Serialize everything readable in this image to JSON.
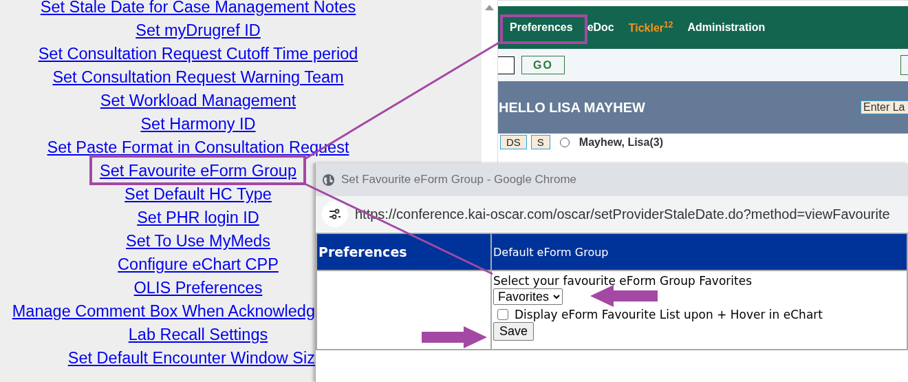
{
  "preference_links": [
    "Set Stale Date for Case Management Notes",
    "Set myDrugref ID",
    "Set Consultation Request Cutoff Time period",
    "Set Consultation Request Warning Team",
    "Set Workload Management",
    "Set Harmony ID",
    "Set Paste Format in Consultation Request",
    "Set Favourite eForm Group",
    "Set Default HC Type",
    "Set PHR login ID",
    "Set To Use MyMeds",
    "Configure eChart CPP",
    "OLIS Preferences",
    "Manage Comment Box When Acknowledg",
    "Lab Recall Settings",
    "Set Default Encounter Window Siz"
  ],
  "emr_window": {
    "nav": [
      {
        "label": "Preferences",
        "kind": "plain"
      },
      {
        "label": "eDoc",
        "kind": "plain"
      },
      {
        "label": "Tickler",
        "kind": "alert",
        "count": "12"
      },
      {
        "label": "Administration",
        "kind": "plain"
      }
    ],
    "search_button": "GO",
    "greeting": "HELLO LISA MAYHEW",
    "search_field": {
      "placeholder": "Enter La"
    },
    "schedule_row": {
      "buttons": [
        "DS",
        "S"
      ],
      "radio_selected": false,
      "provider": "Mayhew, Lisa(3)"
    }
  },
  "popup": {
    "title": "Set Favourite eForm Group - Google Chrome",
    "url": "https://conference.kai-oscar.com/oscar/setProviderStaleDate.do?method=viewFavourite",
    "sidebar_heading": "Preferences",
    "section_heading": "Default eForm Group",
    "prompt": "Select your favourite eForm Group Favorites",
    "group_select": "Favorites",
    "favourite_list_checkbox": {
      "label": "Display eForm Favourite List upon + Hover in eChart",
      "checked": false
    },
    "save_button": "Save"
  }
}
